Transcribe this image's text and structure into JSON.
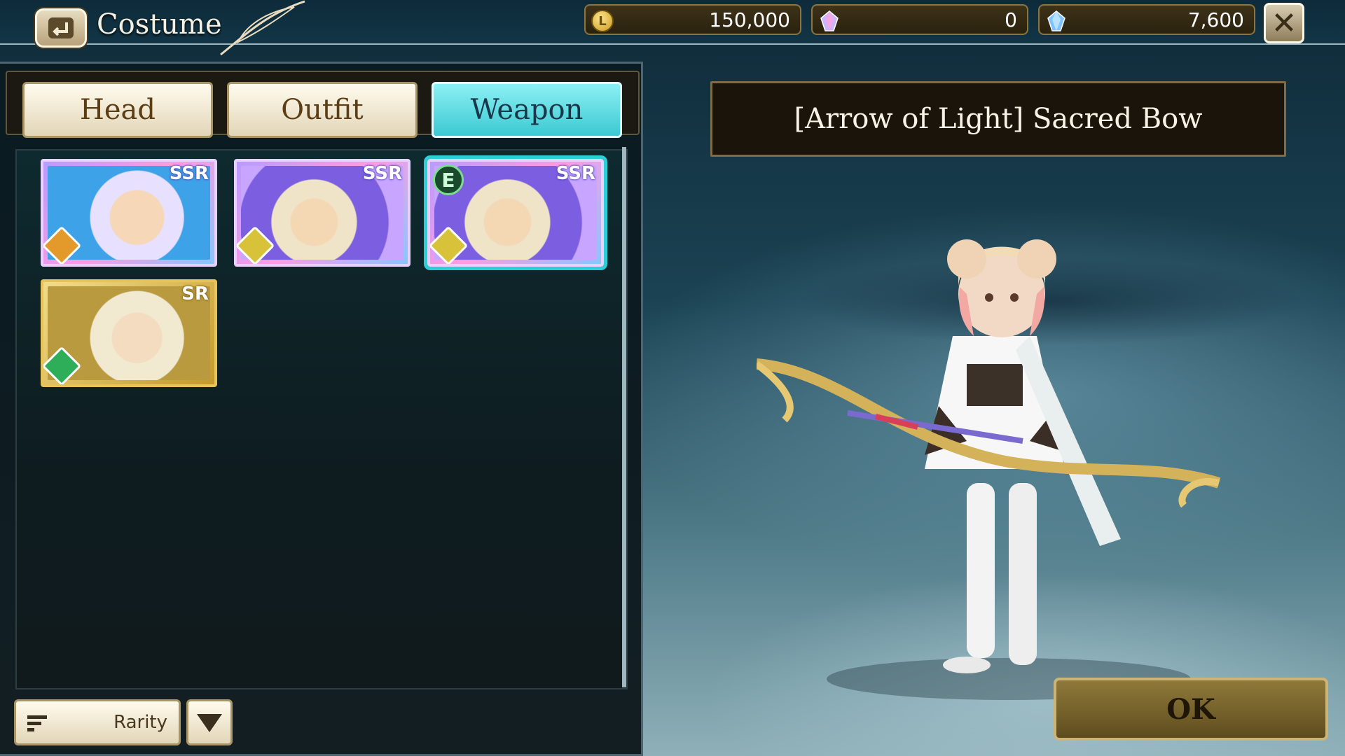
{
  "header": {
    "title": "Costume",
    "currencies": [
      {
        "icon": "gold-coin-icon",
        "value": "150,000"
      },
      {
        "icon": "crystal-icon",
        "value": "0"
      },
      {
        "icon": "blue-crystal-icon",
        "value": "7,600"
      }
    ]
  },
  "tabs": [
    {
      "label": "Head",
      "active": false
    },
    {
      "label": "Outfit",
      "active": false
    },
    {
      "label": "Weapon",
      "active": true
    }
  ],
  "costume_list": [
    {
      "rarity": "SSR",
      "element": "orange",
      "equipped": false,
      "selected": false
    },
    {
      "rarity": "SSR",
      "element": "yellow",
      "equipped": false,
      "selected": false
    },
    {
      "rarity": "SSR",
      "element": "yellow",
      "equipped": true,
      "equipped_label": "E",
      "selected": true
    },
    {
      "rarity": "SR",
      "element": "green",
      "equipped": false,
      "selected": false
    }
  ],
  "sort": {
    "label": "Rarity"
  },
  "preview": {
    "item_name": "[Arrow of Light] Sacred Bow"
  },
  "ok_label": "OK",
  "colors": {
    "active_tab": "#3bc9d2",
    "panel_bg": "#0e1c20",
    "ok_button": "#5e4c1e"
  }
}
